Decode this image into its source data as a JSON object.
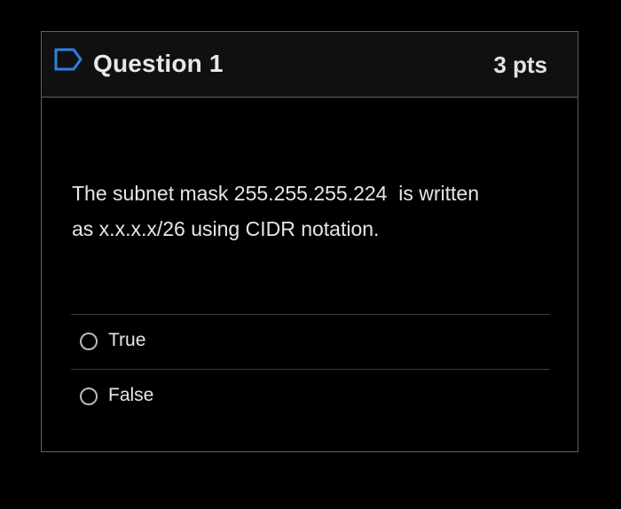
{
  "question": {
    "title": "Question 1",
    "points": "3 pts",
    "text": "The subnet mask 255.255.255.224  is written\nas x.x.x.x/26 using CIDR notation.",
    "flag_icon": "flag-outline-icon"
  },
  "answers": [
    {
      "label": "True",
      "selected": false
    },
    {
      "label": "False",
      "selected": false
    }
  ],
  "colors": {
    "background": "#000000",
    "header_background": "#101012",
    "border": "#5f6165",
    "text": "#e6e6e8"
  }
}
